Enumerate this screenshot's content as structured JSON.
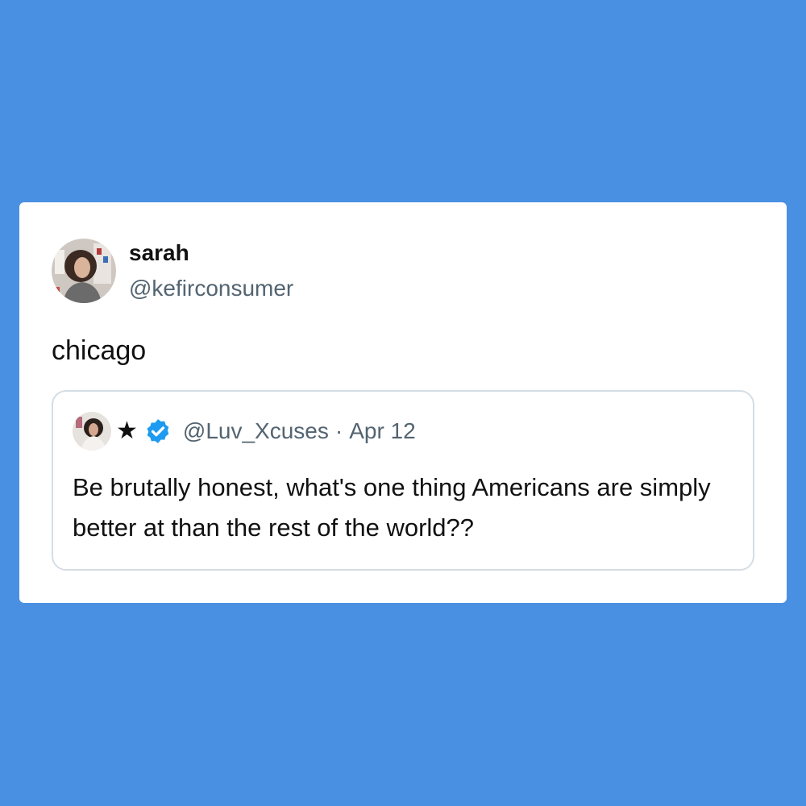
{
  "background_color": "#4a90e2",
  "tweet": {
    "author": {
      "display_name": "sarah",
      "handle": "@kefirconsumer",
      "avatar_icon": "profile-photo"
    },
    "text": "chicago",
    "quoted_tweet": {
      "avatar_icon": "profile-photo",
      "display_name_symbol": "★",
      "verified_icon": "verified-badge-icon",
      "verified_color": "#1d9bf0",
      "handle": "@Luv_Xcuses",
      "separator": "·",
      "date": "Apr 12",
      "text": "Be brutally honest, what's one thing Americans are simply better at than the rest of the world??"
    }
  }
}
